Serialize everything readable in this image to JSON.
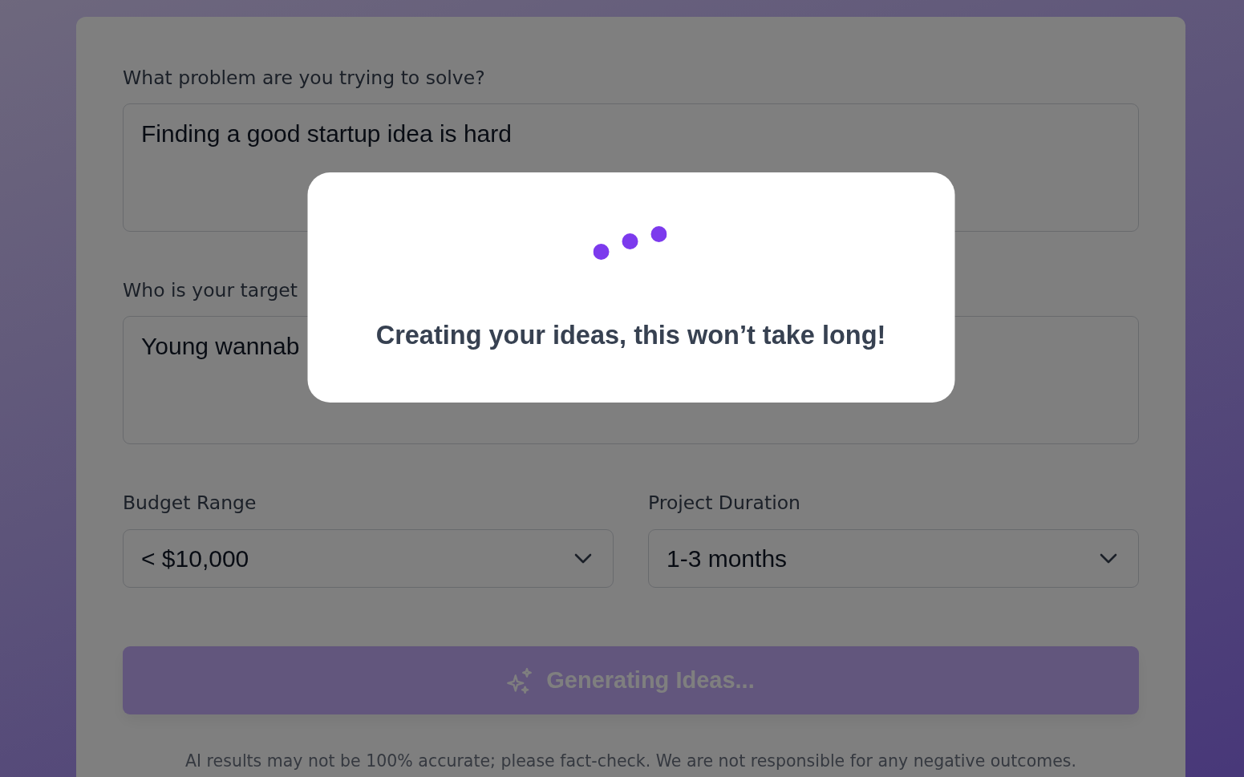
{
  "form": {
    "questions": [
      {
        "label": "What problem are you trying to solve?",
        "value": "Finding a good startup idea is hard"
      },
      {
        "label": "Who is your target",
        "value": "Young wannab"
      }
    ],
    "selects": [
      {
        "label": "Budget Range",
        "value": "< $10,000"
      },
      {
        "label": "Project Duration",
        "value": "1-3 months"
      }
    ],
    "submit_button": {
      "label": "Generating Ideas...",
      "disabled": true
    },
    "disclaimer": "AI results may not be 100% accurate; please fact-check. We are not responsible for any negative outcomes."
  },
  "loading_modal": {
    "message": "Creating your ideas, this won’t take long!"
  }
}
